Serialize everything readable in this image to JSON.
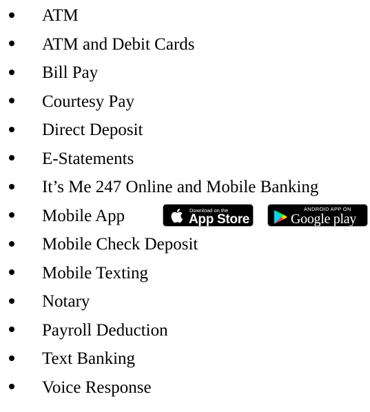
{
  "services": {
    "items": [
      {
        "label": "ATM"
      },
      {
        "label": "ATM and Debit Cards"
      },
      {
        "label": "Bill Pay"
      },
      {
        "label": "Courtesy Pay"
      },
      {
        "label": "Direct Deposit"
      },
      {
        "label": "E-Statements"
      },
      {
        "label": "It’s Me 247 Online and Mobile Banking"
      },
      {
        "label": "Mobile App"
      },
      {
        "label": "Mobile Check Deposit"
      },
      {
        "label": "Mobile Texting"
      },
      {
        "label": "Notary"
      },
      {
        "label": "Payroll Deduction"
      },
      {
        "label": "Text Banking"
      },
      {
        "label": "Voice Response"
      }
    ]
  },
  "badges": {
    "app_store": {
      "small_text": "Download on the",
      "big_text": "App Store",
      "icon": "apple-icon"
    },
    "google_play": {
      "small_text": "ANDROID APP ON",
      "big_text": "Google play",
      "icon": "google-play-icon"
    }
  },
  "colors": {
    "text": "#000000",
    "badge_background": "#000000",
    "badge_text": "#ffffff"
  }
}
